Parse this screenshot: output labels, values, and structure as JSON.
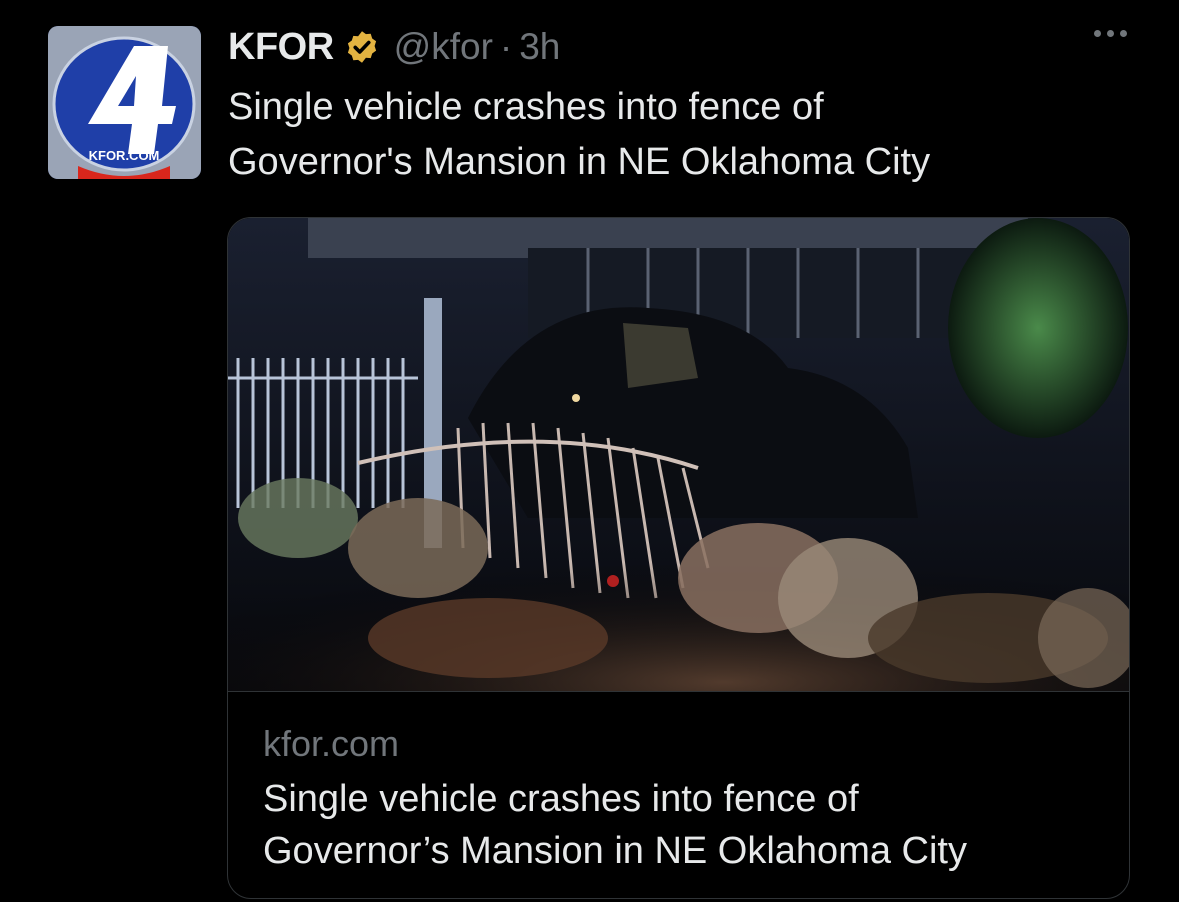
{
  "tweet": {
    "avatar": {
      "brand_text": "KFOR.COM",
      "channel_number": "4",
      "icon": "kfor-logo"
    },
    "display_name": "KFOR",
    "verified_icon": "verified-badge-icon",
    "verified_color": "#e3b341",
    "handle": "@kfor",
    "separator": "·",
    "time": "3h",
    "more_icon": "more-options-icon",
    "text_line1": "Single vehicle crashes into fence of",
    "text_line2": "Governor's Mansion in NE Oklahoma City"
  },
  "card": {
    "image_alt": "Night photo of a vehicle crashed through a wrought iron fence with shrubs in the foreground",
    "domain": "kfor.com",
    "title_line1": "Single vehicle crashes into fence of",
    "title_line2": "Governor’s Mansion in NE Oklahoma City"
  },
  "colors": {
    "background": "#000000",
    "primary_text": "#e7e9ea",
    "secondary_text": "#71767b",
    "border": "#2f3336"
  }
}
